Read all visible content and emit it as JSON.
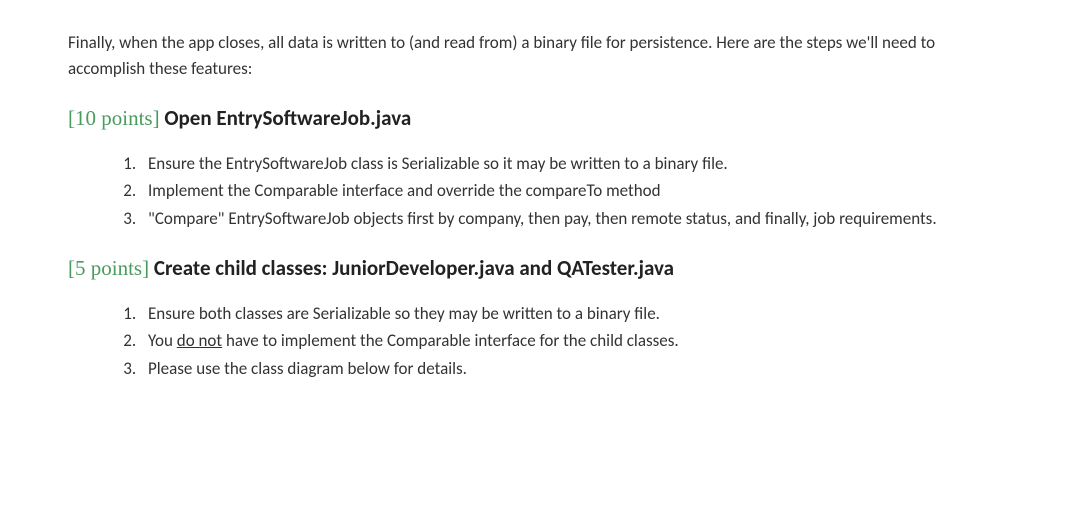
{
  "intro": "Finally, when the app closes, all data is written to (and read from) a binary file for persistence.  Here are the steps we'll need to accomplish these features:",
  "section1": {
    "points": "[10 points]",
    "title": "Open EntrySoftwareJob.java",
    "items": [
      "Ensure the EntrySoftwareJob class is Serializable so it may be written to a binary file.",
      "Implement the Comparable interface and override the compareTo method",
      "\"Compare\" EntrySoftwareJob objects first by company, then pay, then remote status, and finally, job requirements."
    ]
  },
  "section2": {
    "points": "[5 points]",
    "title": "Create child classes: JuniorDeveloper.java and QATester.java",
    "items": [
      "Ensure both classes are Serializable so they may be written to a binary file.",
      {
        "pre": "You ",
        "underline": "do not",
        "post": " have to implement the Comparable interface for the child classes."
      },
      "Please use the class diagram below for details."
    ]
  }
}
